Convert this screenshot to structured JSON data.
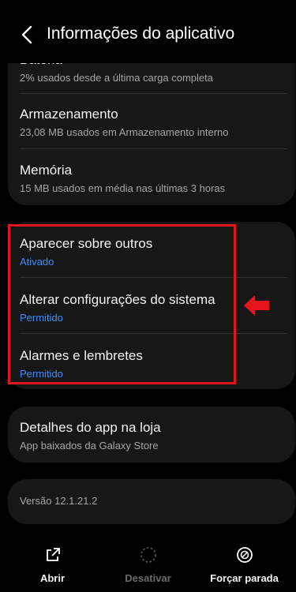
{
  "header": {
    "title": "Informações do aplicativo"
  },
  "card1": {
    "items": [
      {
        "title": "Bateria",
        "subtitle": "2% usados desde a última carga completa"
      },
      {
        "title": "Armazenamento",
        "subtitle": "23,08 MB usados em Armazenamento interno"
      },
      {
        "title": "Memória",
        "subtitle": "15 MB usados em média nas últimas 3 horas"
      }
    ]
  },
  "permissions": {
    "items": [
      {
        "title": "Aparecer sobre outros",
        "status": "Ativado"
      },
      {
        "title": "Alterar configurações do sistema",
        "status": "Permitido"
      },
      {
        "title": "Alarmes e lembretes",
        "status": "Permitido"
      }
    ]
  },
  "store": {
    "title": "Detalhes do app na loja",
    "subtitle": "App baixados da Galaxy Store"
  },
  "version": {
    "text": "Versão 12.1.21.2"
  },
  "bottom_nav": {
    "items": [
      {
        "label": "Abrir",
        "icon": "open-external-icon",
        "enabled": true
      },
      {
        "label": "Desativar",
        "icon": "disable-icon",
        "enabled": false
      },
      {
        "label": "Forçar parada",
        "icon": "force-stop-icon",
        "enabled": true
      }
    ]
  },
  "colors": {
    "background": "#000000",
    "card": "#171717",
    "accent_blue": "#3e8ef7",
    "highlight_red": "#e4161c"
  }
}
